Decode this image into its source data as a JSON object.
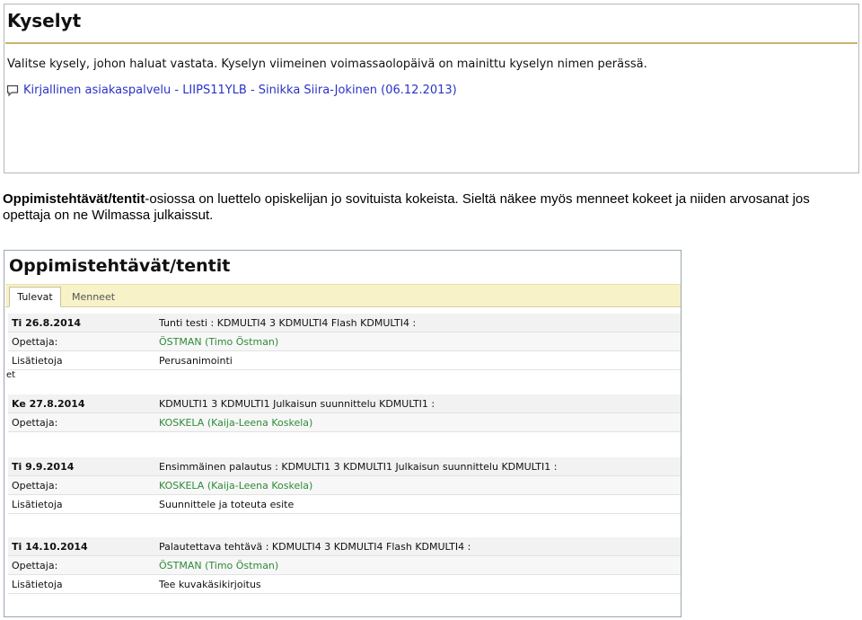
{
  "kyselyt": {
    "title": "Kyselyt",
    "intro": "Valitse kysely, johon haluat vastata. Kyselyn viimeinen voimassaolopäivä on mainittu kyselyn nimen perässä.",
    "link_text": "Kirjallinen asiakaspalvelu - LIIPS11YLB - Sinikka Siira-Jokinen (06.12.2013)",
    "icon": "speech-bubble-icon"
  },
  "caption": {
    "bold": "Oppimistehtävät/tentit",
    "rest": "-osiossa on luettelo opiskelijan jo sovituista kokeista. Sieltä näkee myös menneet kokeet ja niiden arvosanat jos opettaja on ne  Wilmassa julkaissut."
  },
  "oppimistehtavat": {
    "title": "Oppimistehtävät/tentit",
    "tabs": {
      "active": "Tulevat",
      "inactive": "Menneet"
    },
    "stray_text": "et",
    "groups": [
      {
        "date": "Ti 26.8.2014",
        "desc": "Tunti testi : KDMULTI4 3 KDMULTI4 Flash KDMULTI4 :",
        "rows": [
          {
            "label": "Opettaja:",
            "value": "ÖSTMAN (Timo Östman)",
            "green": true
          },
          {
            "label": "Lisätietoja",
            "value": "Perusanimointi",
            "green": false
          }
        ]
      },
      {
        "date": "Ke 27.8.2014",
        "desc": "KDMULTI1 3 KDMULTI1 Julkaisun suunnittelu KDMULTI1 :",
        "rows": [
          {
            "label": "Opettaja:",
            "value": "KOSKELA (Kaija-Leena Koskela)",
            "green": true
          }
        ]
      },
      {
        "date": "Ti 9.9.2014",
        "desc": "Ensimmäinen palautus : KDMULTI1 3 KDMULTI1 Julkaisun suunnittelu KDMULTI1 :",
        "rows": [
          {
            "label": "Opettaja:",
            "value": "KOSKELA (Kaija-Leena Koskela)",
            "green": true
          },
          {
            "label": "Lisätietoja",
            "value": "Suunnittele ja toteuta esite",
            "green": false
          }
        ]
      },
      {
        "date": "Ti 14.10.2014",
        "desc": "Palautettava tehtävä : KDMULTI4 3 KDMULTI4 Flash KDMULTI4 :",
        "rows": [
          {
            "label": "Opettaja:",
            "value": "ÖSTMAN (Timo Östman)",
            "green": true
          },
          {
            "label": "Lisätietoja",
            "value": "Tee kuvakäsikirjoitus",
            "green": false
          }
        ]
      }
    ]
  }
}
